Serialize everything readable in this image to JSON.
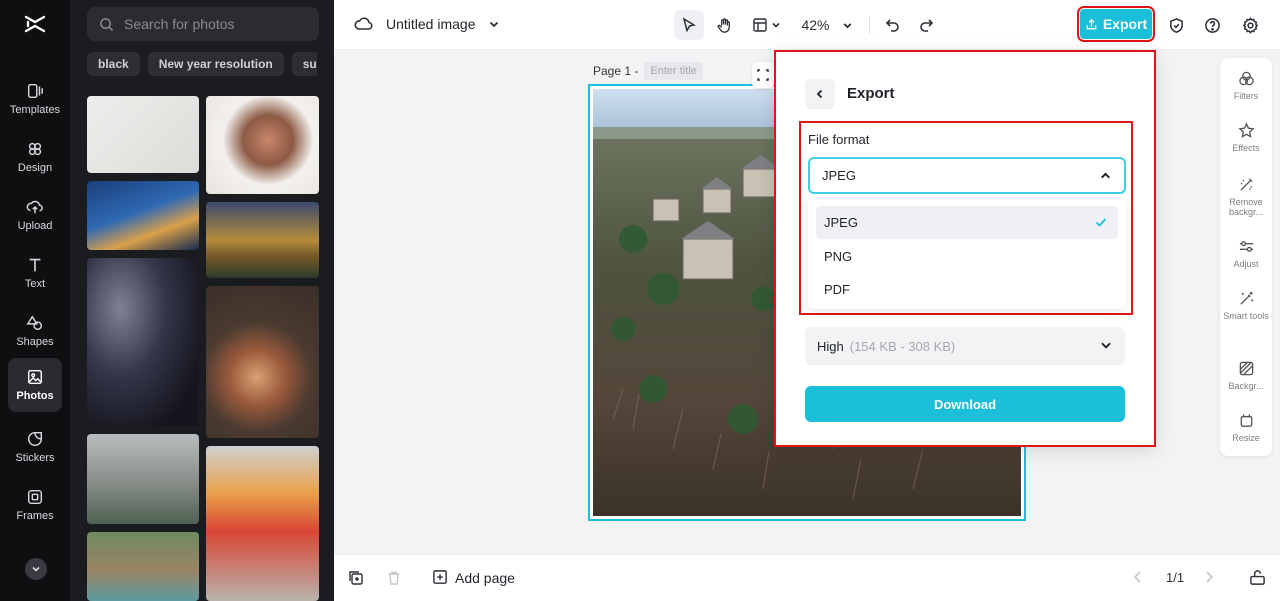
{
  "sidebar": {
    "items": [
      {
        "label": "Templates",
        "icon": "templates-icon"
      },
      {
        "label": "Design",
        "icon": "design-icon"
      },
      {
        "label": "Upload",
        "icon": "upload-icon"
      },
      {
        "label": "Text",
        "icon": "text-icon"
      },
      {
        "label": "Shapes",
        "icon": "shapes-icon"
      },
      {
        "label": "Photos",
        "icon": "photos-icon"
      },
      {
        "label": "Stickers",
        "icon": "stickers-icon"
      },
      {
        "label": "Frames",
        "icon": "frames-icon"
      }
    ],
    "active": "Photos"
  },
  "photos_panel": {
    "search_placeholder": "Search for photos",
    "chips": [
      "black",
      "New year resolution",
      "subs"
    ]
  },
  "topbar": {
    "doc_title": "Untitled image",
    "zoom": "42%",
    "export_label": "Export"
  },
  "canvas": {
    "page_label": "Page 1 -",
    "page_title_placeholder": "Enter title"
  },
  "right_tools": [
    "Filters",
    "Effects",
    "Remove backgr...",
    "Adjust",
    "Smart tools",
    "Backgr...",
    "Resize"
  ],
  "bottombar": {
    "add_page_label": "Add page",
    "page_counter": "1/1"
  },
  "export_panel": {
    "title": "Export",
    "file_format_label": "File format",
    "selected_format": "JPEG",
    "format_options": [
      "JPEG",
      "PNG",
      "PDF"
    ],
    "quality_value": "High",
    "quality_hint": "(154 KB - 308 KB)",
    "download_label": "Download"
  },
  "colors": {
    "accent": "#1cbfd9",
    "highlight": "#e01515",
    "rail_bg": "#0f0f11",
    "panel_bg": "#1b1c20"
  }
}
